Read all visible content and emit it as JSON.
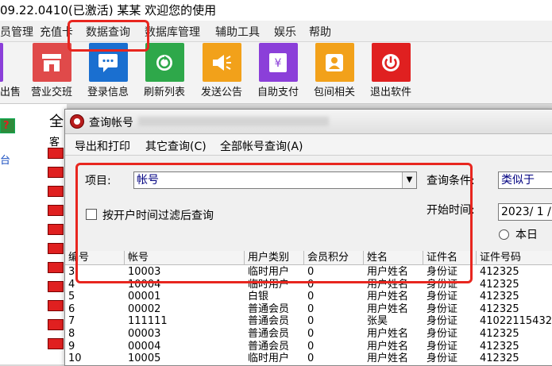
{
  "app": {
    "title": "09.22.0410(已激活)  某某 欢迎您的使用"
  },
  "menu": [
    "员管理",
    "充值卡",
    "数据查询",
    "数据库管理",
    "辅助工具",
    "娱乐",
    "帮助"
  ],
  "toolbar": [
    {
      "label": "出售",
      "icon": "purple-sell-icon",
      "color": "#8b3fd9"
    },
    {
      "label": "营业交班",
      "icon": "shop-icon",
      "color": "#e04a4a"
    },
    {
      "label": "登录信息",
      "icon": "chat-bubble-icon",
      "color": "#1a6fd0"
    },
    {
      "label": "刷新列表",
      "icon": "refresh-icon",
      "color": "#2ea84a"
    },
    {
      "label": "发送公告",
      "icon": "megaphone-icon",
      "color": "#f2a11a"
    },
    {
      "label": "自助支付",
      "icon": "yen-icon",
      "color": "#8b3fd9"
    },
    {
      "label": "包间相关",
      "icon": "person-icon",
      "color": "#f2a11a"
    },
    {
      "label": "退出软件",
      "icon": "power-icon",
      "color": "#e02020"
    }
  ],
  "left": {
    "tab_label": "台"
  },
  "mid": {
    "header_char": "全",
    "sub_char": "客"
  },
  "dialog": {
    "title": "查询帐号",
    "blurred_title_suffix": "…",
    "menu": [
      "导出和打印",
      "其它查询(C)",
      "全部帐号查询(A)"
    ],
    "item_label": "项目:",
    "item_value": "帐号",
    "condition_label": "查询条件:",
    "condition_value": "类似于",
    "checkbox_label": "按开户时间过滤后查询",
    "start_time_label": "开始时间:",
    "start_time_value": "2023/ 1 /",
    "radio_label": "本日"
  },
  "table": {
    "columns": [
      "编号",
      "帐号",
      "用户类别",
      "会员积分",
      "姓名",
      "证件名",
      "证件号码"
    ],
    "rows": [
      [
        "3",
        "10003",
        "临时用户",
        "0",
        "用户姓名",
        "身份证",
        "412325"
      ],
      [
        "4",
        "10004",
        "临时用户",
        "0",
        "用户姓名",
        "身份证",
        "412325"
      ],
      [
        "5",
        "00001",
        "白银",
        "0",
        "用户姓名",
        "身份证",
        "412325"
      ],
      [
        "6",
        "00002",
        "普通会员",
        "0",
        "用户姓名",
        "身份证",
        "412325"
      ],
      [
        "7",
        "111111",
        "普通会员",
        "0",
        "张昊",
        "身份证",
        "41022115432"
      ],
      [
        "8",
        "00003",
        "普通会员",
        "0",
        "用户姓名",
        "身份证",
        "412325"
      ],
      [
        "9",
        "00004",
        "普通会员",
        "0",
        "用户姓名",
        "身份证",
        "412325"
      ],
      [
        "10",
        "10005",
        "临时用户",
        "0",
        "用户姓名",
        "身份证",
        "412325"
      ]
    ]
  },
  "colors": {
    "highlight": "#e8261f"
  }
}
